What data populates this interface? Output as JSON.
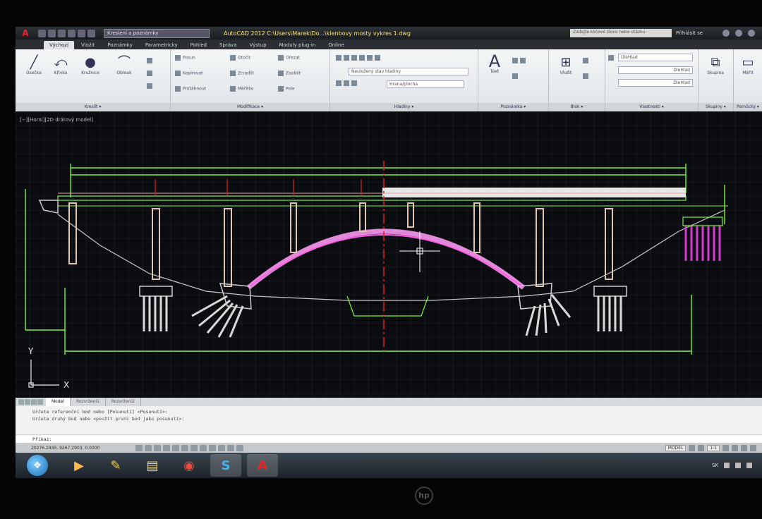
{
  "titlebar": {
    "workspace": "Kreslení a poznámky",
    "document_title": "AutoCAD 2012  C:\\Users\\Marek\\Do...\\klenbovy mosty vykres 1.dwg",
    "search_placeholder": "Zadejte klíčové slovo nebo otázku",
    "signin_label": "Přihlásit se"
  },
  "ribbon_tabs": [
    {
      "label": "Výchozí",
      "active": true
    },
    {
      "label": "Vložit"
    },
    {
      "label": "Poznámky"
    },
    {
      "label": "Parametricky"
    },
    {
      "label": "Pohled"
    },
    {
      "label": "Správa"
    },
    {
      "label": "Výstup"
    },
    {
      "label": "Moduly plug-in"
    },
    {
      "label": "Online"
    }
  ],
  "panels": {
    "draw": {
      "label": "Kreslit ▾",
      "tools": [
        "Úsečka",
        "Křivka",
        "Kružnice",
        "Oblouk"
      ]
    },
    "modify": {
      "label": "Modifikace ▾",
      "tools": [
        "Posun",
        "Otočit",
        "Ořezat",
        "Kopírovat",
        "Zrcadlit",
        "Zaoblit",
        "Protáhnout",
        "Měřítko",
        "Pole"
      ]
    },
    "layers": {
      "label": "Hladiny ▾",
      "dropdown_1": "Neuložený stav hladiny",
      "dropdown_2": "Hrana/plocha"
    },
    "annotation": {
      "label": "Poznámka ▾",
      "text_tool": "Text"
    },
    "block": {
      "label": "Blok ▾",
      "insert_tool": "Vložit"
    },
    "properties": {
      "label": "Vlastnosti ▾",
      "dropdown_1": "DleHlad",
      "dropdown_2": "DleHlad",
      "dropdown_3": "DleHlad"
    },
    "groups": {
      "label": "Skupiny ▾",
      "tool": "Skupina"
    },
    "utilities": {
      "label": "Pomůcky ▾",
      "tool": "Měřit"
    }
  },
  "viewport": {
    "label": "[−][Horní][2D drátový model]",
    "ucs_x": "X",
    "ucs_y": "Y"
  },
  "layout_tabs": [
    {
      "label": "Model",
      "active": true
    },
    {
      "label": "Rozvržení1"
    },
    {
      "label": "Rozvržení2"
    }
  ],
  "command": {
    "history": [
      "Určete referenční bod nebo [Posunutí] <Posunutí>:",
      "Určete druhý bod nebo <použít první bod jako posunutí>:"
    ],
    "prompt": "Příkaz:"
  },
  "status": {
    "coordinates": "20276.2445, 9267.2903, 0.0000",
    "model_label": "MODEL",
    "scale": "1:1"
  },
  "taskbar": {
    "apps": [
      {
        "name": "media-player-icon",
        "glyph": "▶"
      },
      {
        "name": "paint-icon",
        "glyph": "✎"
      },
      {
        "name": "explorer-icon",
        "glyph": "▤"
      },
      {
        "name": "chrome-icon",
        "glyph": "◉"
      },
      {
        "name": "skype-icon",
        "glyph": "S"
      },
      {
        "name": "autocad-icon",
        "glyph": "A"
      }
    ],
    "language": "SK"
  },
  "bezel": {
    "brand": "hp"
  },
  "colors": {
    "cad_green": "#7df23a",
    "cad_red": "#e11d1d",
    "arch_magenta": "#d63ad0",
    "deck_white": "#e7e7e7",
    "viewport_bg": "#0b0c0f"
  }
}
